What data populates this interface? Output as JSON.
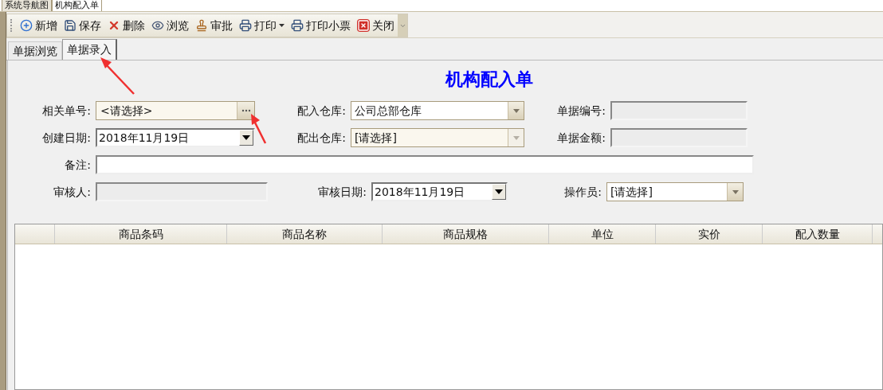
{
  "doc_tabs": [
    {
      "label": "系统导航图",
      "selected": false
    },
    {
      "label": "机构配入单",
      "selected": true
    }
  ],
  "toolbar": [
    {
      "label": "新增",
      "kind": "button"
    },
    {
      "label": "保存",
      "kind": "button"
    },
    {
      "label": "删除",
      "kind": "button"
    },
    {
      "label": "浏览",
      "kind": "button"
    },
    {
      "label": "审批",
      "kind": "button"
    },
    {
      "label": "打印",
      "kind": "menu"
    },
    {
      "label": "打印小票",
      "kind": "button"
    },
    {
      "label": "关闭",
      "kind": "button"
    }
  ],
  "tabs": [
    {
      "label": "单据浏览",
      "selected": false
    },
    {
      "label": "单据录入",
      "selected": true
    }
  ],
  "title": "机构配入单",
  "form_rows": [
    [
      {
        "label": "相关单号:",
        "kind": "picker",
        "value": "<请选择>"
      },
      {
        "label": "配入仓库:",
        "kind": "dropdown",
        "value": "公司总部仓库",
        "disabled": false
      },
      {
        "label": "单据编号:",
        "kind": "readonly"
      }
    ],
    [
      {
        "label": "创建日期:",
        "kind": "date",
        "value": "2018年11月19日"
      },
      {
        "label": "配出仓库:",
        "kind": "dropdown",
        "value": "[请选择]",
        "disabled": true
      },
      {
        "label": "单据金额:",
        "kind": "readonly"
      }
    ],
    [
      {
        "label": "备注:",
        "kind": "text"
      }
    ],
    [
      {
        "label": "审核人:",
        "kind": "readonly"
      },
      {
        "label": "审核日期:",
        "kind": "date",
        "value": "2018年11月19日"
      },
      {
        "label": "操作员:",
        "kind": "dropdown",
        "value": "[请选择]",
        "disabled": false
      }
    ]
  ],
  "table": {
    "columns": [
      "商品条码",
      "商品名称",
      "商品规格",
      "单位",
      "实价",
      "配入数量"
    ]
  }
}
